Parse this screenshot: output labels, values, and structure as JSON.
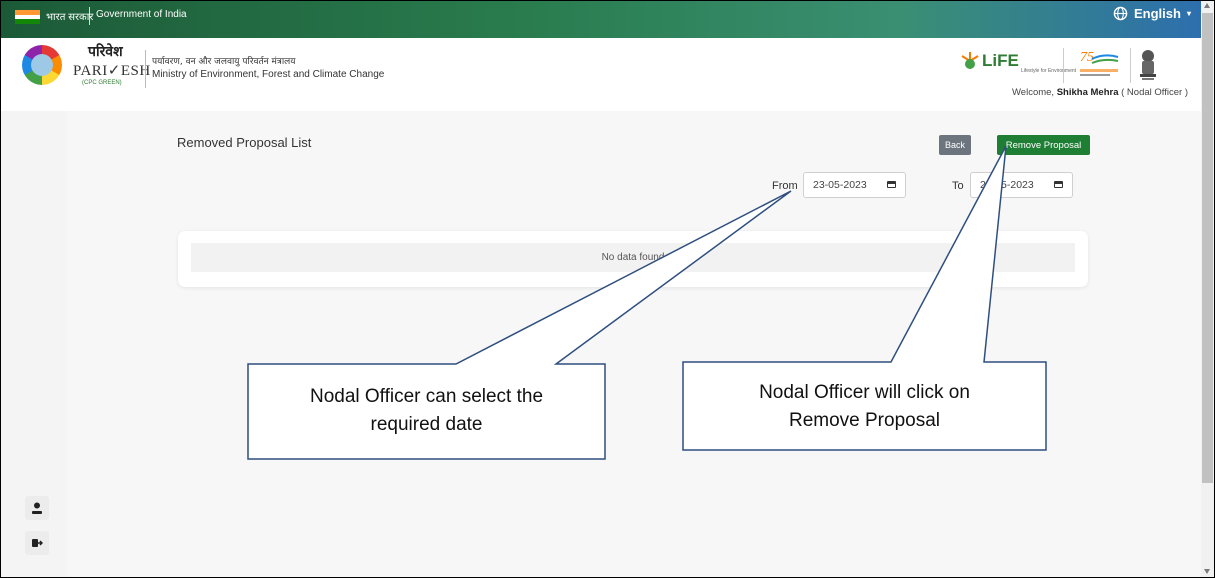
{
  "topbar": {
    "gov_hindi": "भारत सरकार",
    "gov_english": "Government of India",
    "language": "English",
    "colors": {
      "left": "#1c5a37",
      "right": "#2d6fae"
    }
  },
  "header": {
    "brand_hindi": "परिवेश",
    "brand_english": "PARI✓ESH",
    "brand_sub": "(CPC GREEN)",
    "ministry_hindi": "पर्यावरण, वन और जलवायु परिवर्तन मंत्रालय",
    "ministry_english": "Ministry of Environment, Forest and Climate Change",
    "life_logo": "LiFE",
    "life_sub": "Lifestyle for Environment",
    "welcome_prefix": "Welcome,",
    "user_name": "Shikha Mehra",
    "user_role": "( Nodal Officer )"
  },
  "sidebar": {
    "items": [
      {
        "icon": "user-icon"
      },
      {
        "icon": "logout-icon"
      }
    ]
  },
  "page": {
    "title": "Removed Proposal List",
    "back_label": "Back",
    "remove_label": "Remove Proposal",
    "from_label": "From",
    "from_value": "23-05-2023",
    "to_label": "To",
    "to_value": "23-05-2023",
    "empty_message": "No data found",
    "colors": {
      "remove_button": "#1e7e34",
      "back_button": "#6c757d"
    }
  },
  "callouts": {
    "date_hint": "Nodal Officer can select the\nrequired date",
    "remove_hint": "Nodal Officer will click on\nRemove Proposal"
  }
}
